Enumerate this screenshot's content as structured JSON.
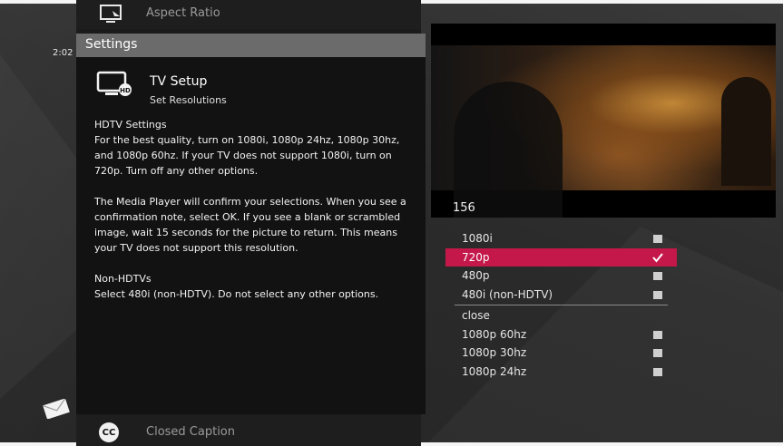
{
  "menu": {
    "top_item": {
      "label": "Aspect Ratio",
      "icon": "aspect-ratio-icon"
    },
    "bottom_item": {
      "label": "Closed Caption",
      "icon_text": "CC",
      "icon": "closed-caption-icon"
    }
  },
  "clock": "2:02",
  "panel": {
    "title": "Settings",
    "setup_title": "TV Setup",
    "setup_subtitle": "Set Resolutions",
    "hdtv_heading": "HDTV Settings",
    "hdtv_text": "For the best quality, turn on 1080i, 1080p 24hz, 1080p 30hz, and 1080p 60hz. If your TV does not support 1080i, turn on 720p. Turn off any other options.",
    "confirm_text": "The Media Player will confirm your selections. When you see a confirmation note, select OK. If you see a blank or scrambled image, wait 15 seconds for the picture to return. This means your TV does not support this resolution.",
    "non_hdtv_heading": "Non-HDTVs",
    "non_hdtv_text": "Select 480i (non-HDTV). Do not select any other options."
  },
  "video": {
    "channel": "156"
  },
  "resolutions": {
    "group1": [
      {
        "label": "1080i",
        "checked": false,
        "selected": false
      },
      {
        "label": "720p",
        "checked": true,
        "selected": true
      },
      {
        "label": "480p",
        "checked": false,
        "selected": false
      },
      {
        "label": "480i (non-HDTV)",
        "checked": false,
        "selected": false
      }
    ],
    "close_label": "close",
    "group2": [
      {
        "label": "1080p 60hz",
        "checked": false,
        "selected": false
      },
      {
        "label": "1080p 30hz",
        "checked": false,
        "selected": false
      },
      {
        "label": "1080p 24hz",
        "checked": false,
        "selected": false
      }
    ]
  },
  "colors": {
    "highlight": "#c4184a",
    "panel_bg": "#121212",
    "header_bg": "#6b6b6b"
  }
}
